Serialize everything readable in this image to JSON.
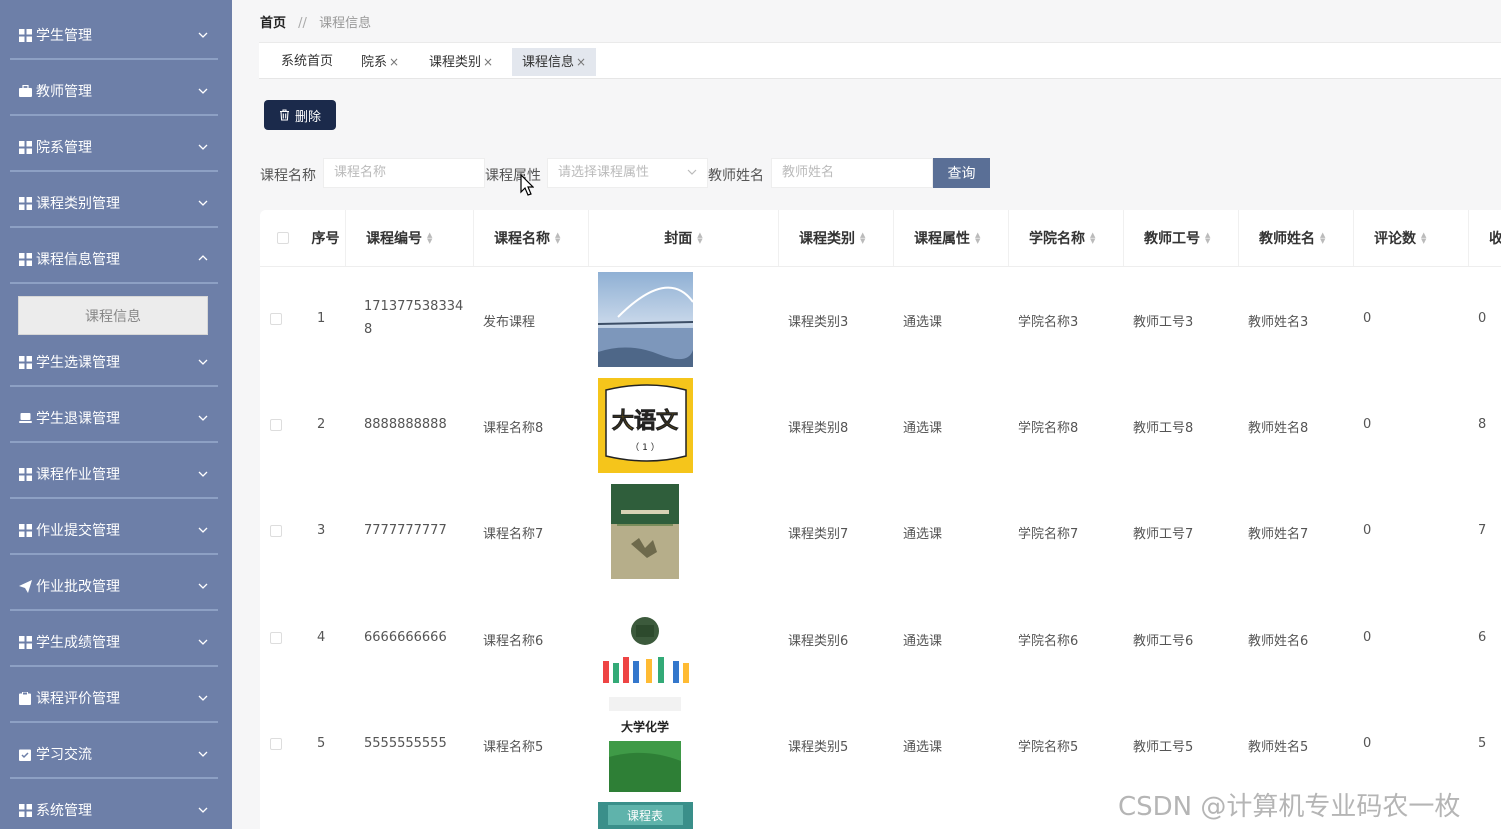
{
  "sidebar": {
    "items": [
      {
        "label": "学生管理",
        "icon": "grid-icon",
        "expanded": false
      },
      {
        "label": "教师管理",
        "icon": "briefcase-icon",
        "expanded": false
      },
      {
        "label": "院系管理",
        "icon": "grid-icon",
        "expanded": false
      },
      {
        "label": "课程类别管理",
        "icon": "grid-icon",
        "expanded": false
      },
      {
        "label": "课程信息管理",
        "icon": "grid-icon",
        "expanded": true
      },
      {
        "label": "学生选课管理",
        "icon": "grid-icon",
        "expanded": false
      },
      {
        "label": "学生退课管理",
        "icon": "laptop-icon",
        "expanded": false
      },
      {
        "label": "课程作业管理",
        "icon": "grid-icon",
        "expanded": false
      },
      {
        "label": "作业提交管理",
        "icon": "grid-icon",
        "expanded": false
      },
      {
        "label": "作业批改管理",
        "icon": "send-icon",
        "expanded": false
      },
      {
        "label": "学生成绩管理",
        "icon": "grid-icon",
        "expanded": false
      },
      {
        "label": "课程评价管理",
        "icon": "clipboard-icon",
        "expanded": false
      },
      {
        "label": "学习交流",
        "icon": "check-clipboard-icon",
        "expanded": false
      },
      {
        "label": "系统管理",
        "icon": "grid-icon",
        "expanded": false
      }
    ],
    "submenu": {
      "label": "课程信息"
    }
  },
  "breadcrumb": {
    "home": "首页",
    "separator": "//",
    "current": "课程信息"
  },
  "tabs": [
    {
      "label": "系统首页",
      "closable": false
    },
    {
      "label": "院系",
      "closable": true
    },
    {
      "label": "课程类别",
      "closable": true
    },
    {
      "label": "课程信息",
      "closable": true,
      "active": true
    }
  ],
  "tab_close_glyph": "×",
  "toolbar": {
    "delete_label": "删除"
  },
  "search": {
    "course_name_label": "课程名称",
    "course_name_placeholder": "课程名称",
    "course_attr_label": "课程属性",
    "course_attr_placeholder": "请选择课程属性",
    "teacher_name_label": "教师姓名",
    "teacher_name_placeholder": "教师姓名",
    "query_label": "查询"
  },
  "table": {
    "headers": [
      "序号",
      "课程编号",
      "课程名称",
      "封面",
      "课程类别",
      "课程属性",
      "学院名称",
      "教师工号",
      "教师姓名",
      "评论数",
      "收"
    ],
    "rows": [
      {
        "index": "1",
        "code_line1": "171377538334",
        "code_line2": "8",
        "name": "发布课程",
        "category": "课程类别3",
        "attr": "通选课",
        "college": "学院名称3",
        "teacher_no": "教师工号3",
        "teacher_name": "教师姓名3",
        "comments": "0",
        "collect": "0",
        "cover": "bridge-photo"
      },
      {
        "index": "2",
        "code_line1": "8888888888",
        "code_line2": "",
        "name": "课程名称8",
        "category": "课程类别8",
        "attr": "通选课",
        "college": "学院名称8",
        "teacher_no": "教师工号8",
        "teacher_name": "教师姓名8",
        "comments": "0",
        "collect": "8",
        "cover": "chinese-book",
        "cover_text": "大语文"
      },
      {
        "index": "3",
        "code_line1": "7777777777",
        "code_line2": "",
        "name": "课程名称7",
        "category": "课程类别7",
        "attr": "通选课",
        "college": "学院名称7",
        "teacher_no": "教师工号7",
        "teacher_name": "教师姓名7",
        "comments": "0",
        "collect": "7",
        "cover": "textbook-green"
      },
      {
        "index": "4",
        "code_line1": "6666666666",
        "code_line2": "",
        "name": "课程名称6",
        "category": "课程类别6",
        "attr": "通选课",
        "college": "学院名称6",
        "teacher_no": "教师工号6",
        "teacher_name": "教师姓名6",
        "comments": "0",
        "collect": "6",
        "cover": "hands-school"
      },
      {
        "index": "5",
        "code_line1": "5555555555",
        "code_line2": "",
        "name": "课程名称5",
        "category": "课程类别5",
        "attr": "通选课",
        "college": "学院名称5",
        "teacher_no": "教师工号5",
        "teacher_name": "教师姓名5",
        "comments": "0",
        "collect": "5",
        "cover": "chemistry-book",
        "cover_text": "大学化学"
      }
    ],
    "partial_cover_text": "课程表"
  },
  "watermark": "CSDN @计算机专业码农一枚",
  "colors": {
    "sidebar": "#6d7fa8",
    "delete_button": "#1b2a4b",
    "query_button": "#5a6f96"
  }
}
